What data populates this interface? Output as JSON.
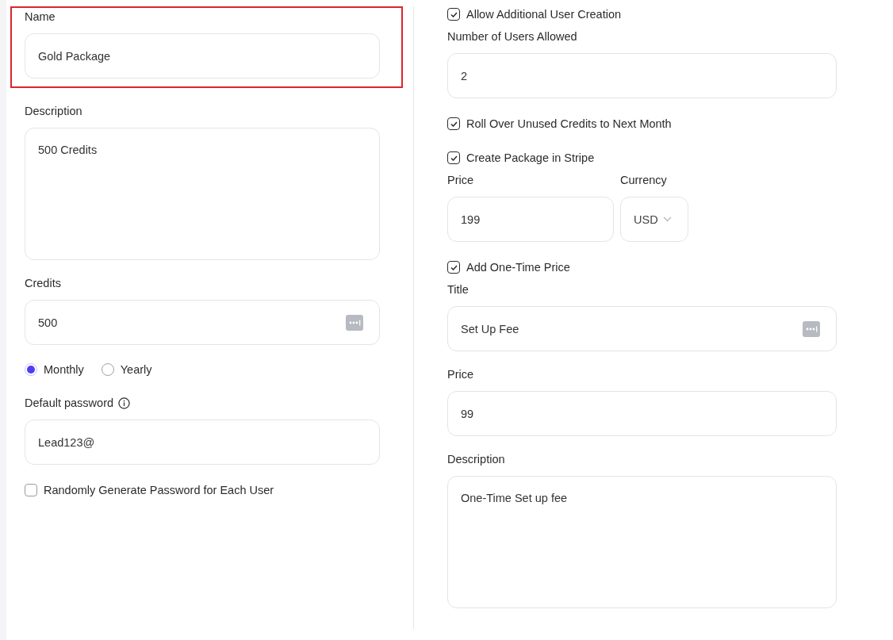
{
  "left_column": [
    {
      "kind": "input",
      "label": "Name",
      "value": "Gold Package",
      "highlighted": true
    },
    {
      "kind": "textarea",
      "label": "Description",
      "value": "500 Credits"
    },
    {
      "kind": "input",
      "label": "Credits",
      "value": "500",
      "menu_icon": true
    },
    {
      "kind": "radios",
      "options": [
        {
          "label": "Monthly",
          "selected": true
        },
        {
          "label": "Yearly",
          "selected": false
        }
      ]
    },
    {
      "kind": "input",
      "label": "Default password",
      "value": "Lead123@",
      "info_icon": true
    },
    {
      "kind": "checkbox",
      "label": "Randomly Generate Password for Each User",
      "checked": false
    }
  ],
  "right_column": [
    {
      "kind": "checkbox",
      "label": "Allow Additional User Creation",
      "checked": true
    },
    {
      "kind": "input",
      "label": "Number of Users Allowed",
      "value": "2"
    },
    {
      "kind": "checkbox",
      "label": "Roll Over Unused Credits to Next Month",
      "checked": true
    },
    {
      "kind": "checkbox",
      "label": "Create Package in Stripe",
      "checked": true
    },
    {
      "kind": "price_currency",
      "price_label": "Price",
      "price_value": "199",
      "currency_label": "Currency",
      "currency_value": "USD"
    },
    {
      "kind": "checkbox",
      "label": "Add One-Time Price",
      "checked": true
    },
    {
      "kind": "input",
      "label": "Title",
      "value": "Set Up Fee",
      "menu_icon": true
    },
    {
      "kind": "input",
      "label": "Price",
      "value": "99"
    },
    {
      "kind": "textarea",
      "label": "Description",
      "value": "One-Time Set up fee"
    }
  ]
}
